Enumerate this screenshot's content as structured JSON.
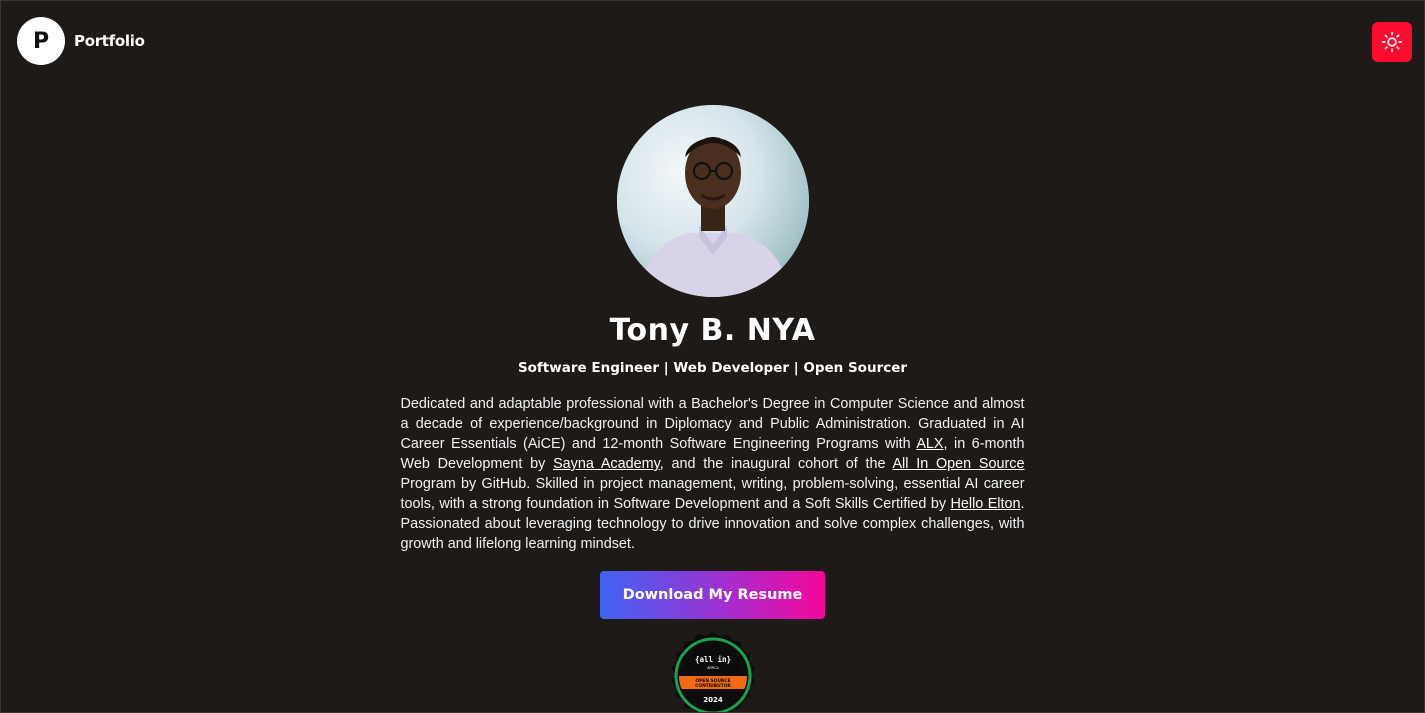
{
  "header": {
    "logo_letter": "P",
    "brand_name": "Portfolio",
    "theme_toggle_icon": "sun-icon"
  },
  "profile": {
    "name": "Tony B. NYA",
    "tagline": "Software Engineer | Web Developer | Open Sourcer",
    "bio": {
      "part1": "Dedicated and adaptable professional with a Bachelor's Degree in Computer Science and almost a decade of experience/background in Diplomacy and Public Administration. Graduated in AI Career Essentials (AiCE) and 12-month Software Engineering Programs with ",
      "link_alx": "ALX",
      "part2": ", in 6-month Web Development by ",
      "link_sayna": "Sayna Academy",
      "part3": ", and the inaugural cohort of the ",
      "link_allin": "All In Open Source",
      "part4": " Program by GitHub. Skilled in project management, writing, problem-solving, essential AI career tools, with a strong foundation in Software Development and a Soft Skills Certified by ",
      "link_hello": "Hello Elton",
      "part5": ". Passionated about leveraging technology to drive innovation and solve complex challenges, with growth and lifelong learning mindset."
    },
    "resume_button": "Download My Resume"
  },
  "badge": {
    "brand": "{all in}",
    "sub": "AFRICA",
    "line1": "OPEN SOURCE",
    "line2": "CONTRIBUTOR",
    "year": "2024"
  },
  "colors": {
    "background": "#1e1a17",
    "toggle": "#ff0a2f",
    "button_gradient_start": "#3f63f5",
    "button_gradient_end": "#f5069a"
  }
}
